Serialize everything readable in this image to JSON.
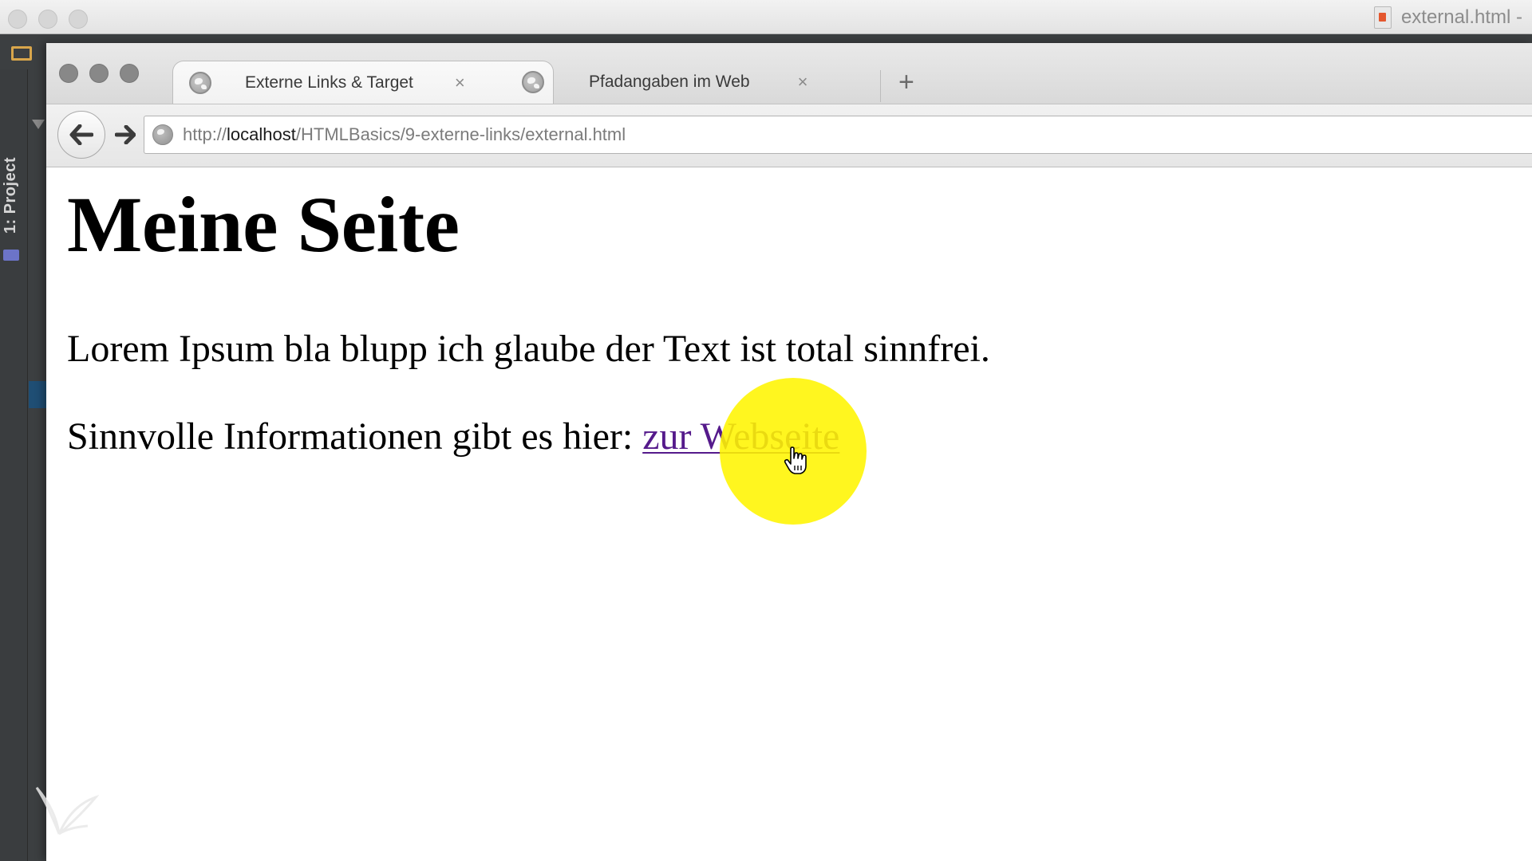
{
  "ide": {
    "window_title": "external.html -",
    "project_panel_label": "1: Project"
  },
  "browser": {
    "tabs": [
      {
        "label": "Externe Links & Target",
        "close": "×",
        "active": true
      },
      {
        "label": "Pfadangaben im Web",
        "close": "×",
        "active": false
      }
    ],
    "new_tab_label": "+",
    "back_label": "🡐",
    "forward_label": "🡒",
    "url": {
      "scheme": "http://",
      "host": "localhost",
      "path": "/HTMLBasics/9-externe-links/external.html"
    }
  },
  "page": {
    "heading": "Meine Seite",
    "paragraph1": "Lorem Ipsum bla blupp ich glaube der Text ist total sinnfrei.",
    "paragraph2_prefix": "Sinnvolle Informationen gibt es hier: ",
    "link_label": "zur Webseite"
  },
  "colors": {
    "link_visited": "#551a8b",
    "cursor_highlight": "#fff500",
    "ide_background": "#3c3f41"
  },
  "icons": {
    "tab_favicon": "globe-icon",
    "url_site": "globe-icon",
    "ide_project": "folder-icon",
    "cursor": "hand-pointer-icon"
  }
}
